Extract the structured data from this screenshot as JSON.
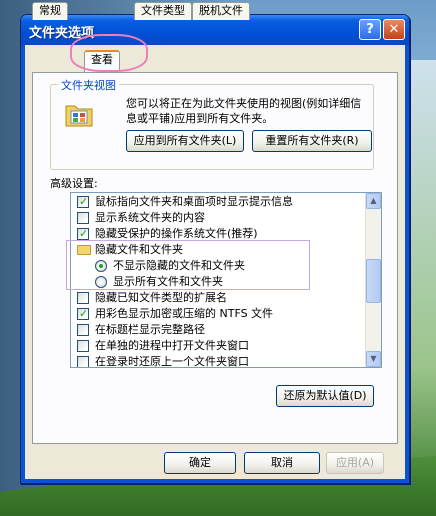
{
  "window": {
    "title": "文件夹选项",
    "help_glyph": "?",
    "close_glyph": "✕"
  },
  "tabs": [
    {
      "label": "常规"
    },
    {
      "label": "查看",
      "active": true
    },
    {
      "label": "文件类型"
    },
    {
      "label": "脱机文件"
    }
  ],
  "folder_views": {
    "title": "文件夹视图",
    "description": "您可以将正在为此文件夹使用的视图(例如详细信息或平铺)应用到所有文件夹。",
    "apply_button": "应用到所有文件夹(L)",
    "reset_button": "重置所有文件夹(R)"
  },
  "advanced": {
    "label": "高级设置:",
    "items": [
      {
        "type": "checkbox",
        "checked": true,
        "label": "鼠标指向文件夹和桌面项时显示提示信息"
      },
      {
        "type": "checkbox",
        "checked": false,
        "label": "显示系统文件夹的内容"
      },
      {
        "type": "checkbox",
        "checked": true,
        "label": "隐藏受保护的操作系统文件(推荐)"
      },
      {
        "type": "folder",
        "label": "隐藏文件和文件夹"
      },
      {
        "type": "radio",
        "selected": true,
        "label": "不显示隐藏的文件和文件夹"
      },
      {
        "type": "radio",
        "selected": false,
        "label": "显示所有文件和文件夹"
      },
      {
        "type": "checkbox",
        "checked": false,
        "label": "隐藏已知文件类型的扩展名"
      },
      {
        "type": "checkbox",
        "checked": true,
        "label": "用彩色显示加密或压缩的 NTFS 文件"
      },
      {
        "type": "checkbox",
        "checked": false,
        "label": "在标题栏显示完整路径"
      },
      {
        "type": "checkbox",
        "checked": false,
        "label": "在单独的进程中打开文件夹窗口"
      },
      {
        "type": "checkbox",
        "checked": false,
        "label": "在登录时还原上一个文件夹窗口"
      }
    ],
    "restore_button": "还原为默认值(D)"
  },
  "footer": {
    "ok": "确定",
    "cancel": "取消",
    "apply": "应用(A)"
  },
  "colors": {
    "titlebar": "#0050d6",
    "dialog_bg": "#ece9d8",
    "group_title": "#0046d5",
    "check_green": "#21a121",
    "tab_highlight": "#ec7fba"
  }
}
